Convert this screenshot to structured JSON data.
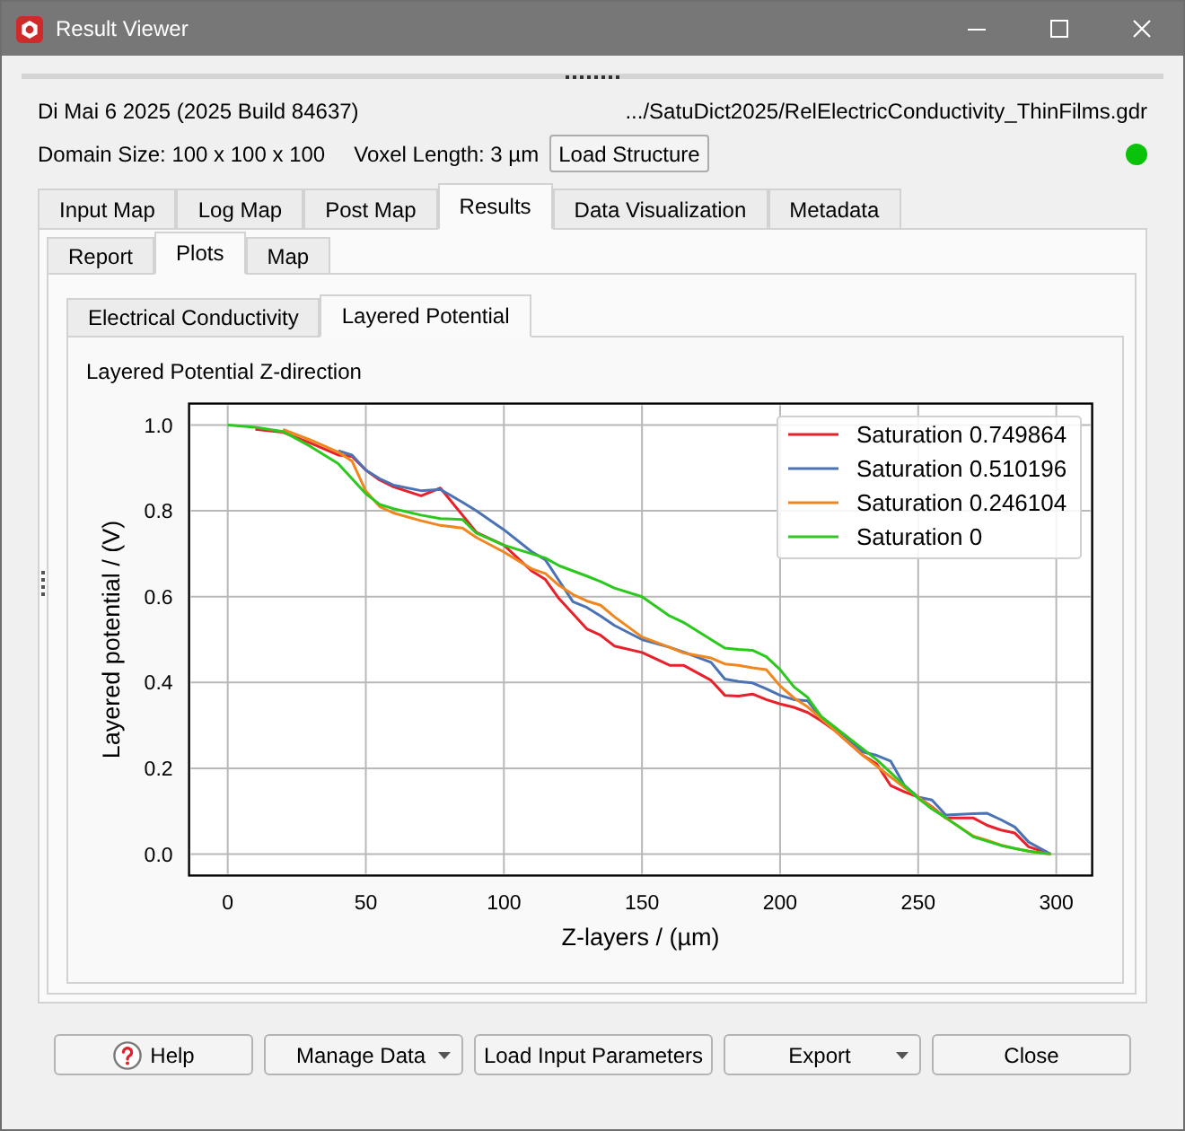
{
  "window": {
    "title": "Result Viewer"
  },
  "header": {
    "build": "Di Mai 6 2025 (2025 Build 84637)",
    "file_path": ".../SatuDict2025/RelElectricConductivity_ThinFilms.gdr",
    "domain_size": "Domain Size: 100 x 100 x 100",
    "voxel_length": "Voxel Length: 3 µm",
    "load_button": "Load Structure",
    "indicator": {
      "on": true
    }
  },
  "tabs": [
    {
      "label": "Input Map",
      "selected": false
    },
    {
      "label": "Log Map",
      "selected": false
    },
    {
      "label": "Post Map",
      "selected": false
    },
    {
      "label": "Results",
      "selected": true
    },
    {
      "label": "Data Visualization",
      "selected": false
    },
    {
      "label": "Metadata",
      "selected": false
    }
  ],
  "sub_tabs": [
    {
      "label": "Report",
      "selected": false
    },
    {
      "label": "Plots",
      "selected": true
    },
    {
      "label": "Map",
      "selected": false
    }
  ],
  "plot_tabs": [
    {
      "label": "Electrical Conductivity",
      "selected": false
    },
    {
      "label": "Layered Potential",
      "selected": true
    }
  ],
  "plot": {
    "chart_data": {
      "type": "line",
      "title": "Layered Potential Z-direction",
      "xlabel": "Z-layers / (µm)",
      "ylabel": "Layered potential / (V)",
      "x": [
        0,
        10,
        20,
        30,
        40,
        45,
        50,
        55,
        60,
        70,
        77,
        85,
        90,
        100,
        110,
        115,
        120,
        125,
        130,
        135,
        140,
        150,
        160,
        165,
        175,
        180,
        185,
        190,
        195,
        200,
        205,
        210,
        215,
        220,
        230,
        235,
        240,
        245,
        250,
        255,
        260,
        270,
        275,
        280,
        285,
        290,
        298
      ],
      "series": [
        {
          "name": "Saturation 0.749864",
          "color": "#e8202a",
          "values": [
            null,
            0.99,
            0.983,
            0.958,
            0.93,
            0.927,
            0.895,
            0.872,
            0.856,
            0.835,
            0.853,
            0.79,
            0.75,
            0.72,
            0.66,
            0.64,
            0.595,
            0.56,
            0.525,
            0.51,
            0.485,
            0.47,
            0.44,
            0.44,
            0.405,
            0.37,
            0.368,
            0.373,
            0.36,
            0.35,
            0.342,
            0.33,
            0.31,
            0.287,
            0.23,
            0.21,
            0.16,
            0.145,
            0.133,
            0.11,
            0.084,
            0.084,
            0.067,
            0.056,
            0.049,
            0.017,
            0.0
          ]
        },
        {
          "name": "Saturation 0.510196",
          "color": "#4a72b4",
          "values": [
            null,
            null,
            null,
            null,
            0.94,
            0.93,
            0.895,
            0.875,
            0.86,
            0.847,
            0.85,
            0.82,
            0.8,
            0.756,
            0.705,
            0.686,
            0.637,
            0.588,
            0.575,
            0.555,
            0.533,
            0.5,
            0.482,
            0.471,
            0.447,
            0.408,
            0.402,
            0.399,
            0.385,
            0.37,
            0.36,
            0.357,
            0.315,
            0.294,
            0.238,
            0.23,
            0.217,
            0.16,
            0.133,
            0.126,
            0.091,
            0.094,
            0.095,
            0.08,
            0.063,
            0.028,
            0.0
          ]
        },
        {
          "name": "Saturation 0.246104",
          "color": "#f0861e",
          "values": [
            null,
            null,
            0.99,
            0.965,
            0.937,
            0.916,
            0.846,
            0.81,
            0.795,
            0.777,
            0.766,
            0.76,
            0.738,
            0.704,
            0.665,
            0.654,
            0.626,
            0.605,
            0.59,
            0.58,
            0.553,
            0.506,
            0.482,
            0.469,
            0.457,
            0.443,
            0.44,
            0.434,
            0.43,
            0.392,
            0.364,
            0.343,
            0.315,
            0.287,
            0.23,
            0.205,
            0.18,
            0.155,
            0.133,
            0.108,
            0.084,
            0.042,
            0.032,
            0.021,
            0.013,
            0.007,
            0.0
          ]
        },
        {
          "name": "Saturation 0",
          "color": "#2cc81e",
          "values": [
            1.0,
            0.995,
            0.985,
            0.95,
            0.91,
            0.875,
            0.84,
            0.815,
            0.805,
            0.79,
            0.782,
            0.78,
            0.748,
            0.72,
            0.7,
            0.69,
            0.672,
            0.66,
            0.648,
            0.635,
            0.62,
            0.6,
            0.555,
            0.54,
            0.5,
            0.48,
            0.477,
            0.475,
            0.46,
            0.43,
            0.39,
            0.365,
            0.32,
            0.295,
            0.245,
            0.22,
            0.19,
            0.16,
            0.13,
            0.105,
            0.085,
            0.04,
            0.03,
            0.02,
            0.013,
            0.007,
            0.0
          ]
        }
      ],
      "xlim": [
        -14,
        313
      ],
      "ylim": [
        -0.05,
        1.05
      ],
      "xticks": [
        0,
        50,
        100,
        150,
        200,
        250,
        300
      ],
      "yticks": [
        {
          "value": 0,
          "label": "0.0"
        },
        {
          "value": 0.2,
          "label": "0.2"
        },
        {
          "value": 0.4,
          "label": "0.4"
        },
        {
          "value": 0.6,
          "label": "0.6"
        },
        {
          "value": 0.8,
          "label": "0.8"
        },
        {
          "value": 1,
          "label": "1.0"
        }
      ],
      "grid": true,
      "legend": "upper right"
    }
  },
  "buttons": [
    {
      "label": "Help",
      "kind": "help"
    },
    {
      "label": "Manage Data",
      "kind": "dropdown"
    },
    {
      "label": "Load Input Parameters",
      "kind": "plain"
    },
    {
      "label": "Export",
      "kind": "dropdown"
    },
    {
      "label": "Close",
      "kind": "plain"
    }
  ]
}
